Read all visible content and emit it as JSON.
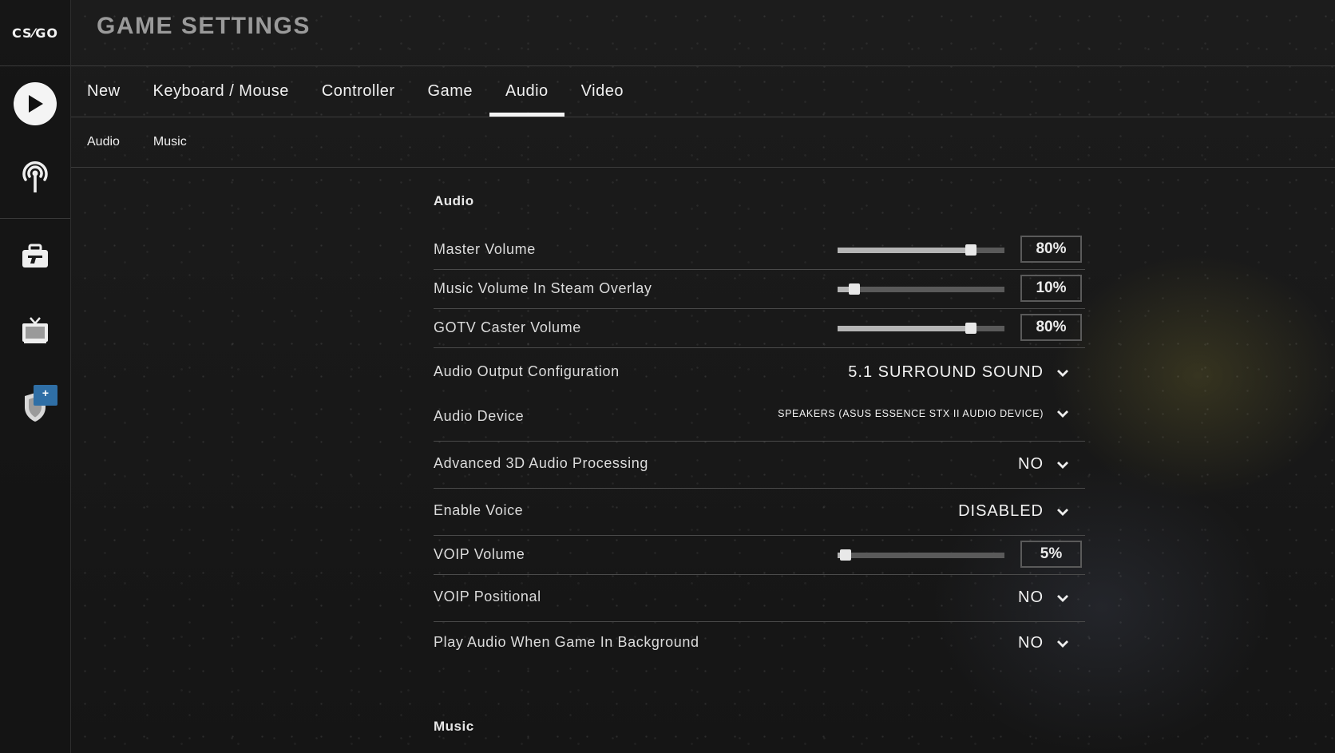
{
  "app": {
    "logo_text": "CS⁄GO"
  },
  "header": {
    "title": "GAME SETTINGS"
  },
  "rail": {
    "items": [
      {
        "name": "play",
        "icon": "play-icon"
      },
      {
        "name": "broadcast",
        "icon": "broadcast-icon"
      },
      {
        "name": "inventory",
        "icon": "briefcase-icon"
      },
      {
        "name": "watch",
        "icon": "tv-icon"
      },
      {
        "name": "operation",
        "icon": "shield-icon",
        "badge": "+"
      }
    ]
  },
  "tabs": [
    {
      "label": "New"
    },
    {
      "label": "Keyboard / Mouse"
    },
    {
      "label": "Controller"
    },
    {
      "label": "Game"
    },
    {
      "label": "Audio",
      "active": true
    },
    {
      "label": "Video"
    }
  ],
  "subtabs": [
    {
      "label": "Audio"
    },
    {
      "label": "Music"
    }
  ],
  "audio_section": {
    "heading": "Audio",
    "master_volume": {
      "label": "Master Volume",
      "value": "80%",
      "level": 0.8
    },
    "music_overlay_volume": {
      "label": "Music Volume In Steam Overlay",
      "value": "10%",
      "level": 0.1
    },
    "gotv_caster_volume": {
      "label": "GOTV Caster Volume",
      "value": "80%",
      "level": 0.8
    },
    "output_config": {
      "label": "Audio Output Configuration",
      "value": "5.1 SURROUND SOUND"
    },
    "audio_device": {
      "label": "Audio Device",
      "value": "SPEAKERS (ASUS ESSENCE STX II AUDIO DEVICE)"
    },
    "advanced_3d": {
      "label": "Advanced 3D Audio Processing",
      "value": "NO"
    },
    "enable_voice": {
      "label": "Enable Voice",
      "value": "DISABLED"
    },
    "voip_volume": {
      "label": "VOIP Volume",
      "value": "5%",
      "level": 0.05
    },
    "voip_positional": {
      "label": "VOIP Positional",
      "value": "NO"
    },
    "play_in_background": {
      "label": "Play Audio When Game In Background",
      "value": "NO"
    }
  },
  "music_section": {
    "heading": "Music"
  },
  "colors": {
    "accent": "#f4f4f4",
    "badge": "#2f6fa6",
    "background": "#1a1a1a"
  }
}
